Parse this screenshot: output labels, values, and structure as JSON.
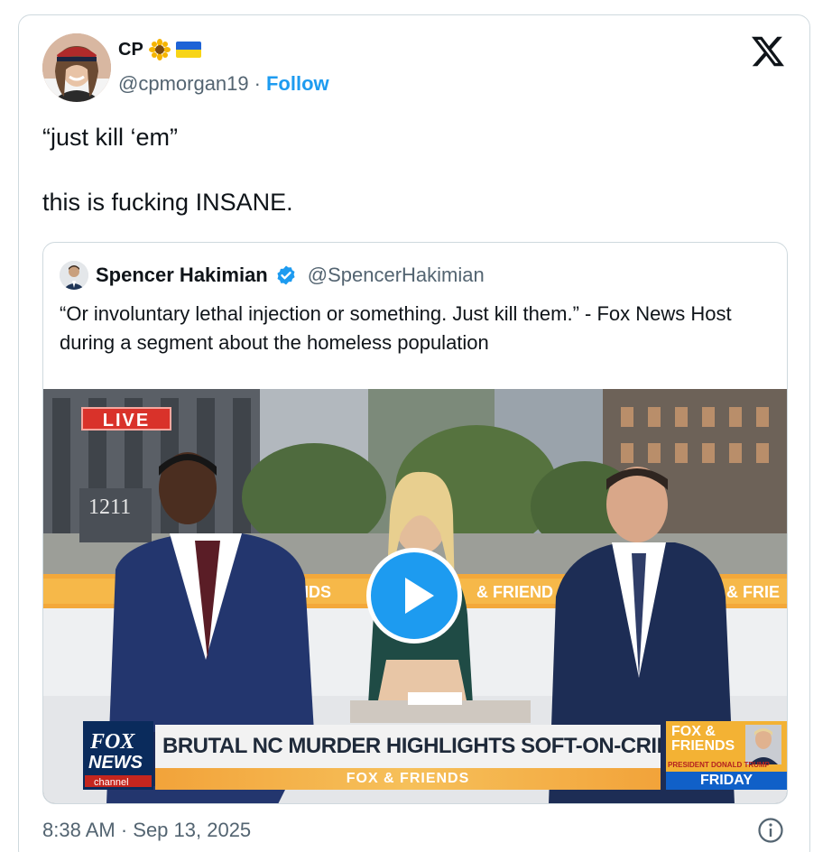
{
  "author": {
    "display_name": "CP",
    "handle": "@cpmorgan19",
    "separator": "·",
    "follow_label": "Follow",
    "emoji": [
      "sunflower-icon",
      "ukraine-flag-icon"
    ]
  },
  "tweet": {
    "text": "“just kill ‘em”\n\nthis is fucking INSANE."
  },
  "quoted": {
    "display_name": "Spencer Hakimian",
    "handle": "@SpencerHakimian",
    "verified": true,
    "text": "“Or involuntary lethal injection or something. Just kill them.” - Fox News Host during a segment about the homeless population"
  },
  "video": {
    "live_badge": "LIVE",
    "building_number": "1211",
    "fox_logo_lines": [
      "FOX",
      "NEWS",
      "channel"
    ],
    "headline": "BRUTAL NC MURDER HIGHLIGHTS SOFT-ON-CRIME POLICIES",
    "show_name": "FOX & FRIENDS",
    "side_box": {
      "top": "FOX & FRIENDS",
      "president": "PRESIDENT DONALD TRUMP",
      "day": "FRIDAY"
    },
    "banner_text": "FRIENDS"
  },
  "footer": {
    "timestamp": "8:38 AM · Sep 13, 2025"
  },
  "colors": {
    "accent": "#1d9bf0",
    "text": "#0f1419",
    "muted": "#536471",
    "border": "#cfd9de"
  }
}
